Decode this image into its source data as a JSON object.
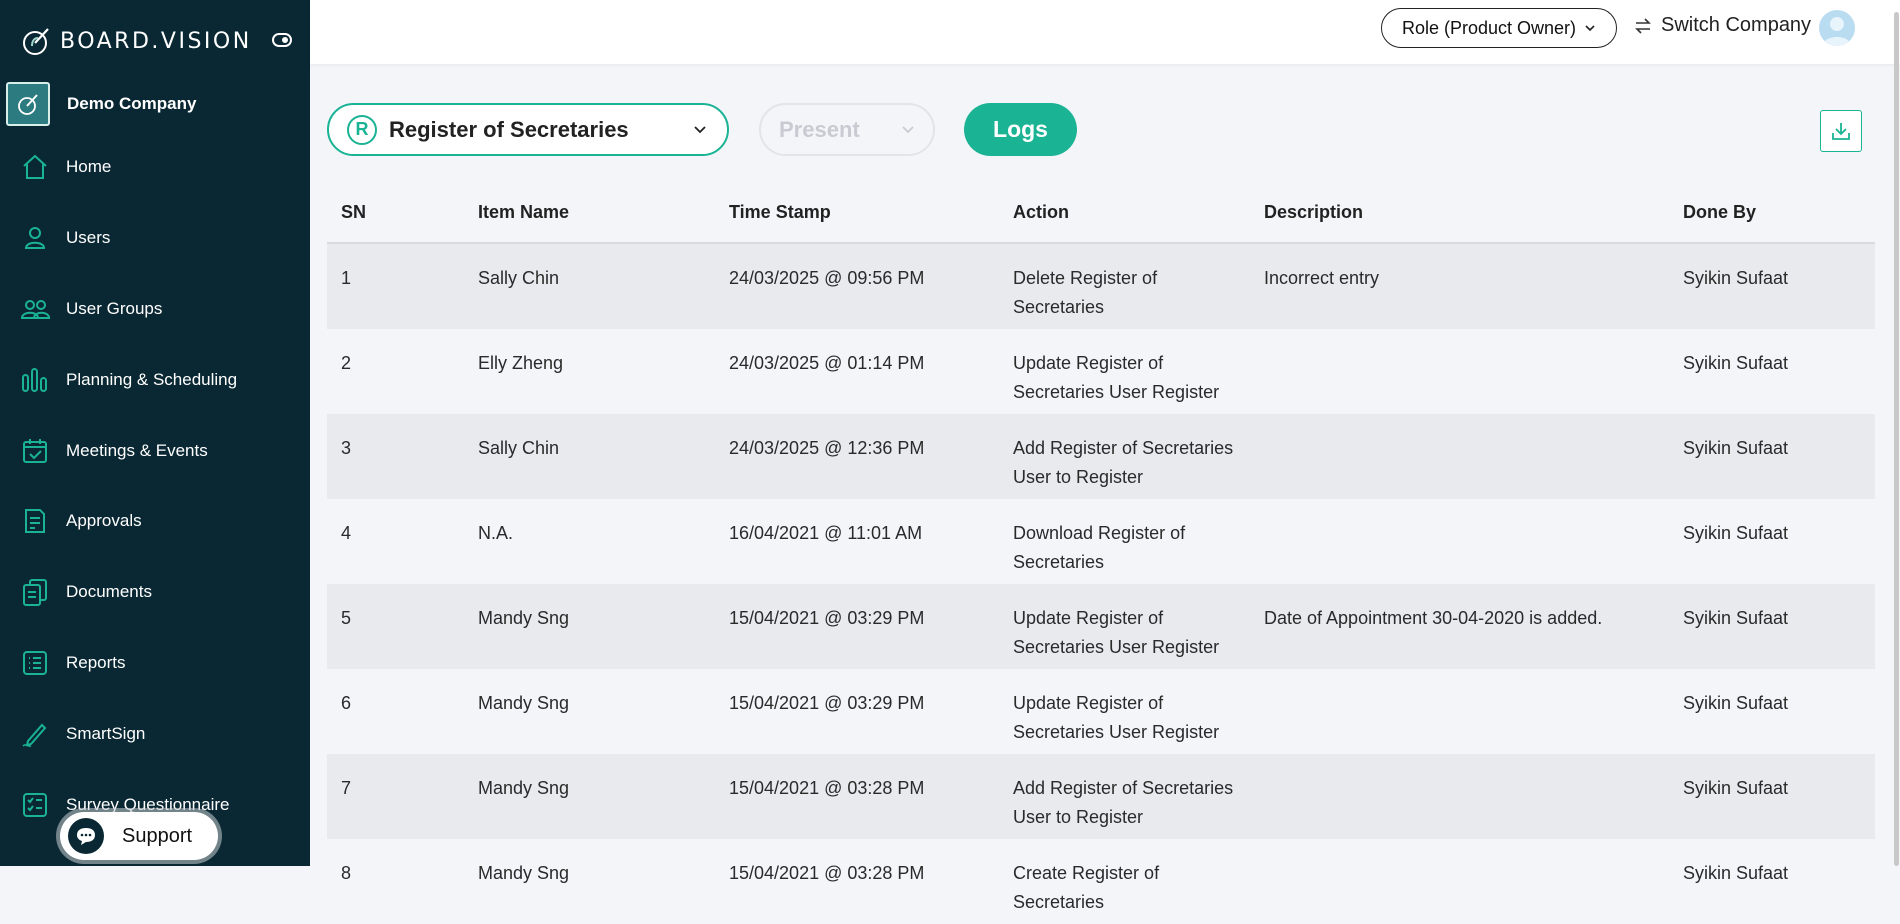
{
  "brand": {
    "name": "BOARD.VISION"
  },
  "company": {
    "name": "Demo Company"
  },
  "sidebar": {
    "items": [
      {
        "label": "Home",
        "icon": "home-icon"
      },
      {
        "label": "Users",
        "icon": "user-icon"
      },
      {
        "label": "User Groups",
        "icon": "user-group-icon"
      },
      {
        "label": "Planning & Scheduling",
        "icon": "bar-chart-icon"
      },
      {
        "label": "Meetings & Events",
        "icon": "calendar-check-icon"
      },
      {
        "label": "Approvals",
        "icon": "approval-document-icon"
      },
      {
        "label": "Documents",
        "icon": "documents-icon"
      },
      {
        "label": "Reports",
        "icon": "report-list-icon"
      },
      {
        "label": "SmartSign",
        "icon": "pen-sign-icon"
      },
      {
        "label": "Survey Questionnaire",
        "icon": "survey-checklist-icon"
      }
    ],
    "support_label": "Support"
  },
  "header": {
    "role_label": "Role (Product Owner)",
    "switch_company_label": "Switch Company"
  },
  "filters": {
    "register_badge": "R",
    "register_value": "Register of Secretaries",
    "status_value": "Present",
    "logs_label": "Logs"
  },
  "table": {
    "columns": [
      "SN",
      "Item Name",
      "Time Stamp",
      "Action",
      "Description",
      "Done By"
    ],
    "rows": [
      {
        "sn": "1",
        "item": "Sally Chin",
        "time": "24/03/2025 @ 09:56 PM",
        "action": "Delete Register of Secretaries",
        "description": "Incorrect entry",
        "done_by": "Syikin Sufaat"
      },
      {
        "sn": "2",
        "item": "Elly Zheng",
        "time": "24/03/2025 @ 01:14 PM",
        "action": "Update Register of Secretaries User Register",
        "description": "",
        "done_by": "Syikin Sufaat"
      },
      {
        "sn": "3",
        "item": "Sally Chin",
        "time": "24/03/2025 @ 12:36 PM",
        "action": "Add Register of Secretaries User to Register",
        "description": "",
        "done_by": "Syikin Sufaat"
      },
      {
        "sn": "4",
        "item": "N.A.",
        "time": "16/04/2021 @ 11:01 AM",
        "action": "Download Register of Secretaries",
        "description": "",
        "done_by": "Syikin Sufaat"
      },
      {
        "sn": "5",
        "item": "Mandy Sng",
        "time": "15/04/2021 @ 03:29 PM",
        "action": "Update Register of Secretaries User Register",
        "description": "Date of Appointment 30-04-2020 is added.",
        "done_by": "Syikin Sufaat"
      },
      {
        "sn": "6",
        "item": "Mandy Sng",
        "time": "15/04/2021 @ 03:29 PM",
        "action": "Update Register of Secretaries User Register",
        "description": "",
        "done_by": "Syikin Sufaat"
      },
      {
        "sn": "7",
        "item": "Mandy Sng",
        "time": "15/04/2021 @ 03:28 PM",
        "action": "Add Register of Secretaries User to Register",
        "description": "",
        "done_by": "Syikin Sufaat"
      },
      {
        "sn": "8",
        "item": "Mandy Sng",
        "time": "15/04/2021 @ 03:28 PM",
        "action": "Create Register of Secretaries",
        "description": "",
        "done_by": "Syikin Sufaat"
      }
    ]
  },
  "colors": {
    "accent": "#1ab394",
    "sidebar_bg": "#0a2833",
    "row_alt": "#e8eaee"
  }
}
